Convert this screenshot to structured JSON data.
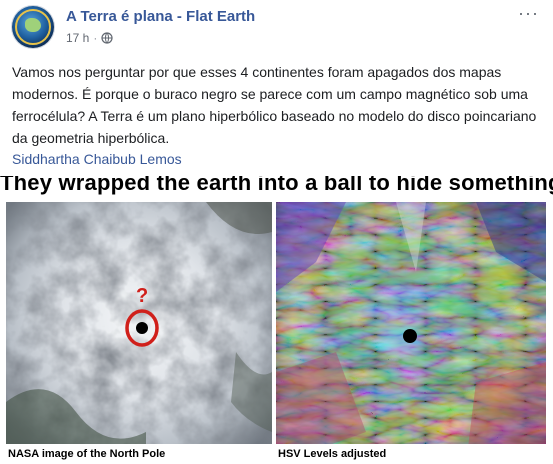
{
  "header": {
    "page_name": "A Terra é plana - Flat Earth",
    "time": "17 h",
    "separator": "·",
    "privacy_icon": "globe-icon",
    "more_icon": "more-options-icon"
  },
  "post": {
    "text": "Vamos nos perguntar por que esses 4 continentes foram apagados dos mapas modernos. É porque o buraco negro se parece com um campo magnético sob uma ferrocélula? A Terra é um plano hiperbólico baseado no modelo do disco poincariano da geometria hiperbólica.",
    "author_link": "Siddhartha Chaibub Lemos"
  },
  "meme": {
    "caption": "They wrapped the earth into a ball to hide something.",
    "left_label": "NASA image of the North Pole",
    "right_label": "HSV Levels adjusted",
    "question_mark": "?",
    "colors": {
      "circle_red": "#d0201b",
      "link_blue": "#385898"
    }
  }
}
